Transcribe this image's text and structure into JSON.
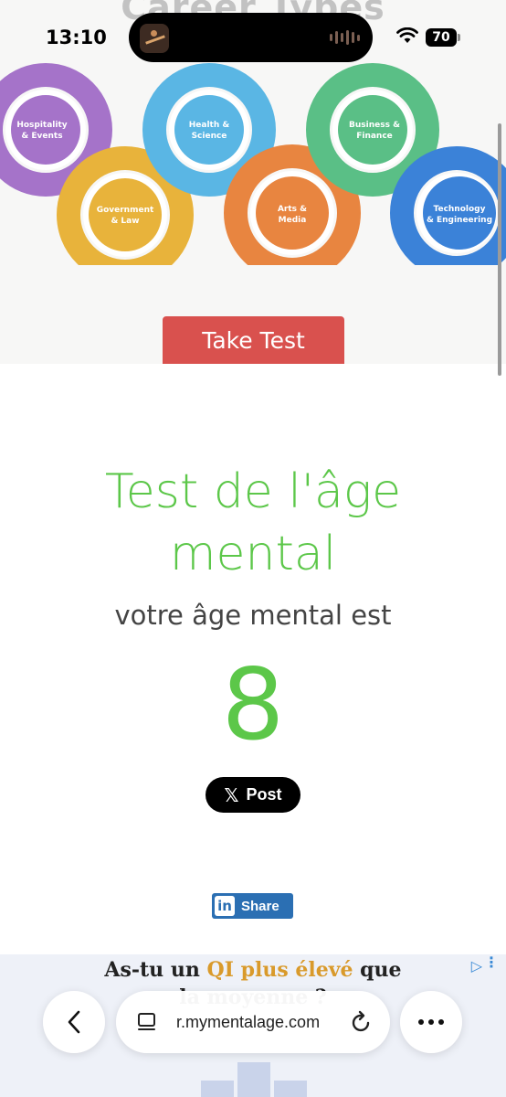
{
  "status": {
    "time": "13:10",
    "battery": "70"
  },
  "banner": {
    "title": "Career Types",
    "careers": [
      {
        "line1": "Hospitality",
        "line2": "& Events",
        "color": "#a573c9"
      },
      {
        "line1": "Government",
        "line2": "& Law",
        "color": "#e8b33b"
      },
      {
        "line1": "Health &",
        "line2": "Science",
        "color": "#5ab6e4"
      },
      {
        "line1": "Arts &",
        "line2": "Media",
        "color": "#e88540"
      },
      {
        "line1": "Business &",
        "line2": "Finance",
        "color": "#5abf86"
      },
      {
        "line1": "Technology",
        "line2": "& Engineering",
        "color": "#3b82d8"
      }
    ],
    "button": "Take Test"
  },
  "result": {
    "title": "Test de l'âge mental",
    "subtitle": "votre âge mental est",
    "age": "8"
  },
  "share": {
    "x_post": "Post",
    "linkedin": "Share",
    "linkedin_logo": "in"
  },
  "ad": {
    "line1_start": "As-tu un ",
    "line1_highlight": "QI plus élevé",
    "line1_end": " que",
    "line2": "la moyenne ?"
  },
  "browser": {
    "url": "r.mymentalage.com"
  },
  "colors": {
    "accent_green": "#5cc749",
    "button_red": "#d9514e",
    "linkedin_blue": "#2b6fb3"
  },
  "icons": [
    "wifi-icon",
    "battery-icon",
    "back-arrow-icon",
    "tabs-icon",
    "reload-icon",
    "more-dots-icon",
    "x-logo-icon",
    "linkedin-logo-icon",
    "ad-choices-icon"
  ]
}
